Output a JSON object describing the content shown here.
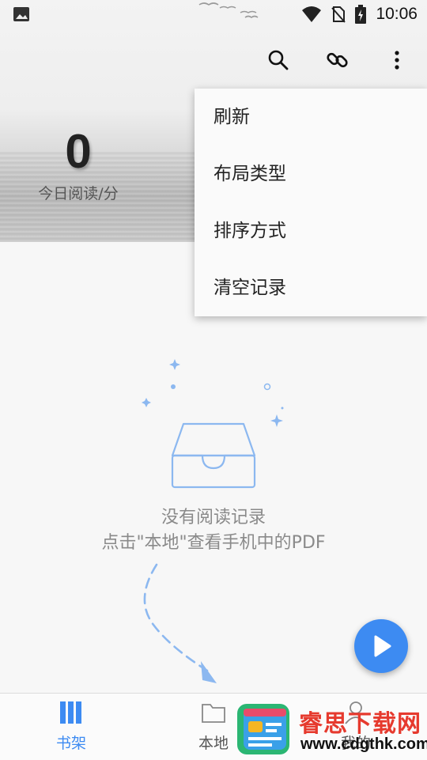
{
  "status_bar": {
    "time": "10:06",
    "icons": [
      "image-icon",
      "wifi-icon",
      "no-sim-icon",
      "battery-charging-icon"
    ]
  },
  "toolbar": {
    "icons": [
      "search-icon",
      "link-icon",
      "more-vert-icon"
    ]
  },
  "reading_stat": {
    "value": "0",
    "label": "今日阅读/分"
  },
  "overflow_menu": {
    "items": [
      {
        "label": "刷新"
      },
      {
        "label": "布局类型"
      },
      {
        "label": "排序方式"
      },
      {
        "label": "清空记录"
      }
    ]
  },
  "empty_state": {
    "title": "没有阅读记录",
    "subtitle": "点击\"本地\"查看手机中的PDF",
    "icon": "empty-inbox-icon"
  },
  "fab": {
    "icon": "play-icon"
  },
  "bottom_nav": {
    "items": [
      {
        "label": "书架",
        "icon": "bookshelf-icon",
        "active": true
      },
      {
        "label": "本地",
        "icon": "folder-icon",
        "active": false
      },
      {
        "label": "我的",
        "icon": "profile-icon",
        "active": false
      }
    ]
  },
  "watermark": {
    "title": "睿思下载网",
    "url": "www.cdgthk.com"
  },
  "colors": {
    "accent": "#3d8bf2",
    "illustration": "#8cb8f0",
    "text_muted": "#8a8a8a",
    "watermark_red": "#e63a2e"
  }
}
